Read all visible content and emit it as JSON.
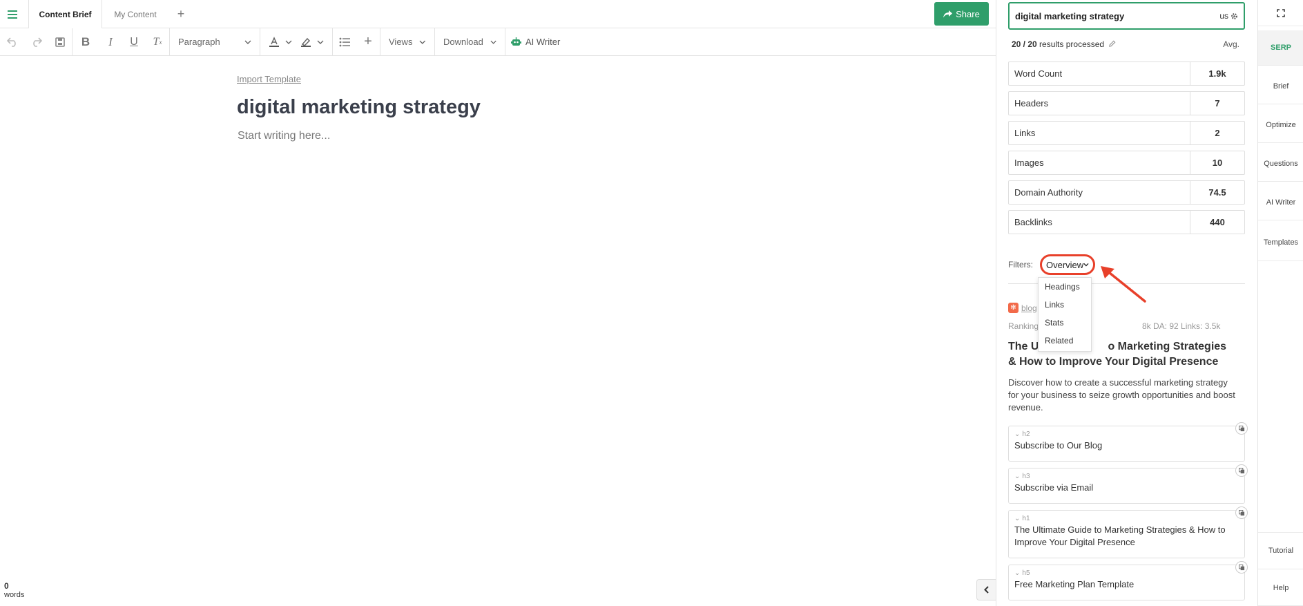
{
  "tabs": {
    "content_brief": "Content Brief",
    "my_content": "My Content"
  },
  "share_label": "Share",
  "toolbar": {
    "block_format": "Paragraph",
    "views_label": "Views",
    "download_label": "Download",
    "ai_writer_label": "AI Writer"
  },
  "editor": {
    "import_template": "Import Template",
    "title": "digital marketing strategy",
    "placeholder": "Start writing here...",
    "word_count": "0",
    "word_label": "words"
  },
  "serp": {
    "keyword": "digital marketing strategy",
    "location": "us",
    "processed": "20 / 20",
    "processed_suffix": "results processed",
    "avg_label": "Avg.",
    "metrics": [
      {
        "label": "Word Count",
        "value": "1.9k"
      },
      {
        "label": "Headers",
        "value": "7"
      },
      {
        "label": "Links",
        "value": "2"
      },
      {
        "label": "Images",
        "value": "10"
      },
      {
        "label": "Domain Authority",
        "value": "74.5"
      },
      {
        "label": "Backlinks",
        "value": "440"
      }
    ],
    "filters_label": "Filters:",
    "filter_selected": "Overview",
    "filter_options": [
      "Headings",
      "Links",
      "Stats",
      "Related"
    ],
    "result": {
      "source": "blog",
      "ranking_label": "Ranking",
      "meta_right": "8k  DA: 92  Links: 3.5k",
      "title_part1": "The U",
      "title_part2": "o Marketing Strategies",
      "title_line2": "& How to Improve Your Digital Presence",
      "description": "Discover how to create a successful marketing strategy for your business to seize growth opportunities and boost revenue.",
      "headings": [
        {
          "tag": "h2",
          "text": "Subscribe to Our Blog"
        },
        {
          "tag": "h3",
          "text": "Subscribe via Email"
        },
        {
          "tag": "h1",
          "text": "The Ultimate Guide to Marketing Strategies & How to Improve Your Digital Presence"
        },
        {
          "tag": "h5",
          "text": "Free Marketing Plan Template"
        }
      ]
    }
  },
  "rail": [
    "SERP",
    "Brief",
    "Optimize",
    "Questions",
    "AI Writer",
    "Templates",
    "Tutorial",
    "Help"
  ],
  "colors": {
    "accent_green": "#2f9e6a",
    "highlight_red": "#e8402a"
  }
}
